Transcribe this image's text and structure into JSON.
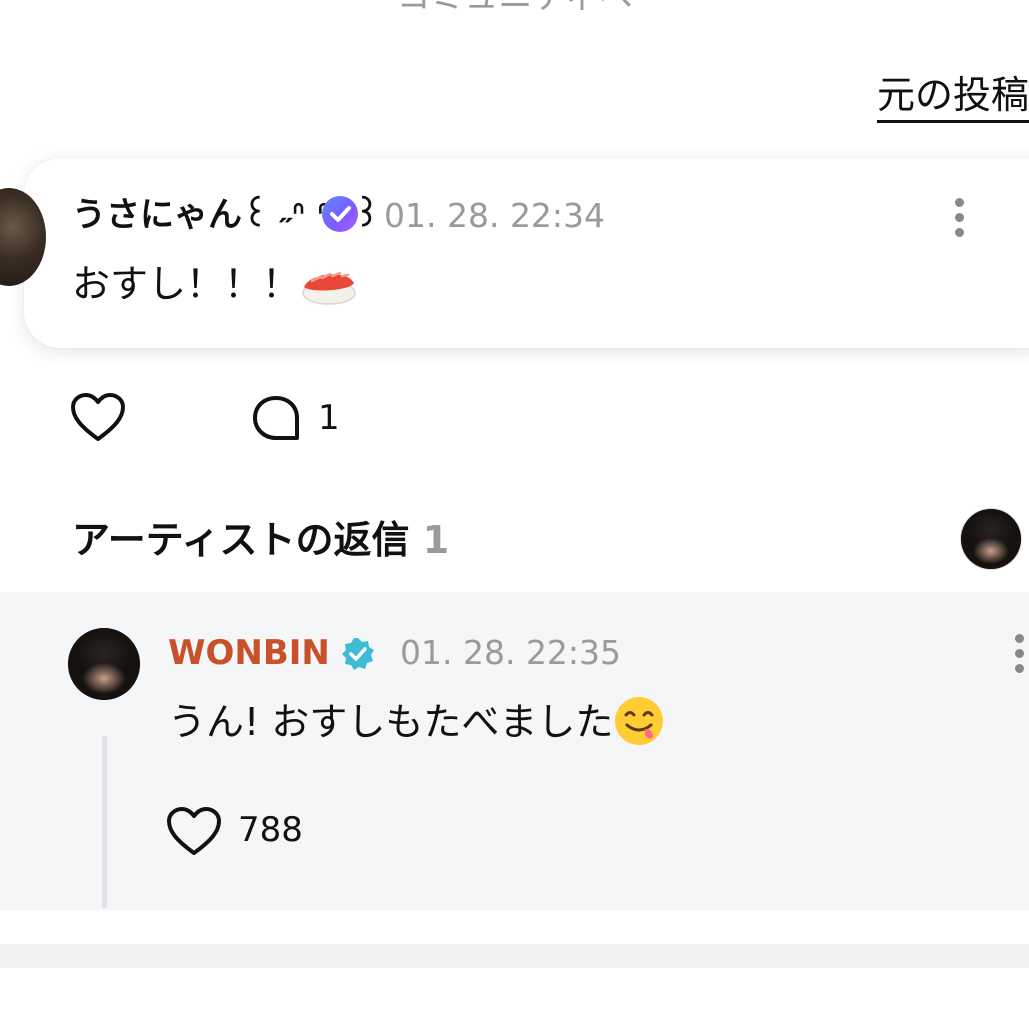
{
  "header": {
    "top_text": "コミュニティへ",
    "original_post_link": "元の投稿"
  },
  "comment": {
    "username": "うさにゃん꒰ ˶ᐢ ᐢ˶ ꒱",
    "verified_icon": "fan-badge-icon",
    "timestamp": "01. 28. 22:34",
    "content": "おすし！！！",
    "content_emoji": "sushi",
    "reply_count": "1"
  },
  "artist_replies": {
    "title": "アーティストの返信",
    "count": "1"
  },
  "reply": {
    "username": "WONBIN",
    "verified_icon": "artist-verified-badge-icon",
    "timestamp": "01. 28. 22:35",
    "content": "うん! おすしもたべました",
    "content_emoji": "face-savoring-food",
    "like_count": "788"
  },
  "colors": {
    "artist_name": "#c8502a",
    "artist_badge": "#3dbcd4",
    "timestamp": "#9a9a9a",
    "reply_bg": "#f5f6f8"
  }
}
